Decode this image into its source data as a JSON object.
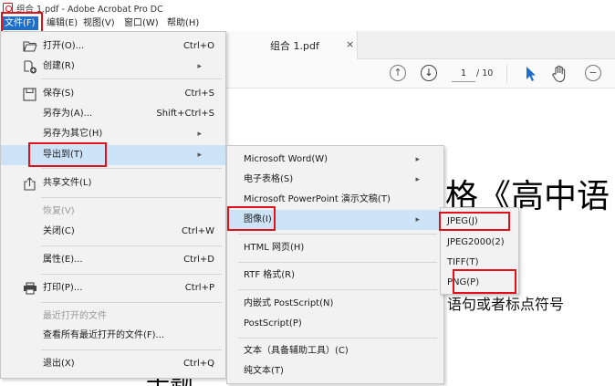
{
  "window": {
    "title": "组合 1.pdf - Adobe Acrobat Pro DC"
  },
  "menubar": {
    "items": [
      {
        "id": "file",
        "label": "文件(F)"
      },
      {
        "id": "edit",
        "label": "编辑(E)"
      },
      {
        "id": "view",
        "label": "视图(V)"
      },
      {
        "id": "window",
        "label": "窗口(W)"
      },
      {
        "id": "help",
        "label": "帮助(H)"
      }
    ]
  },
  "tab": {
    "title": "组合 1.pdf",
    "close": "×"
  },
  "toolbar": {
    "page_current": "1",
    "page_total": "/ 10"
  },
  "file_menu": {
    "open": {
      "label": "打开(O)...",
      "shortcut": "Ctrl+O"
    },
    "create": {
      "label": "创建(R)"
    },
    "save": {
      "label": "保存(S)",
      "shortcut": "Ctrl+S"
    },
    "save_as": {
      "label": "另存为(A)...",
      "shortcut": "Shift+Ctrl+S"
    },
    "save_as_other": {
      "label": "另存为其它(H)"
    },
    "export_to": {
      "label": "导出到(T)"
    },
    "share": {
      "label": "共享文件(L)"
    },
    "revert": {
      "label": "恢复(V)"
    },
    "close": {
      "label": "关闭(C)",
      "shortcut": "Ctrl+W"
    },
    "properties": {
      "label": "属性(E)...",
      "shortcut": "Ctrl+D"
    },
    "print": {
      "label": "打印(P)...",
      "shortcut": "Ctrl+P"
    },
    "recent": {
      "label": "最近打开的文件"
    },
    "view_all_recent": {
      "label": "查看所有最近打开的文件(F)..."
    },
    "exit": {
      "label": "退出(X)",
      "shortcut": "Ctrl+Q"
    }
  },
  "export_menu": {
    "word": {
      "label": "Microsoft Word(W)"
    },
    "spreadsheet": {
      "label": "电子表格(S)"
    },
    "powerpoint": {
      "label": "Microsoft PowerPoint 演示文稿(T)"
    },
    "image": {
      "label": "图像(I)"
    },
    "html": {
      "label": "HTML 网页(H)"
    },
    "rtf": {
      "label": "RTF 格式(R)"
    },
    "eps": {
      "label": "内嵌式 PostScript(N)"
    },
    "postscript": {
      "label": "PostScript(P)"
    },
    "accessible_text": {
      "label": "文本（具备辅助工具）(C)"
    },
    "plain_text": {
      "label": "纯文本(T)"
    }
  },
  "image_menu": {
    "jpeg": {
      "label": "JPEG(J)"
    },
    "jpeg2000": {
      "label": "JPEG2000(2)"
    },
    "tiff": {
      "label": "TIFF(T)"
    },
    "png": {
      "label": "PNG(P)"
    }
  },
  "document": {
    "heading_fragment": "格《高中语",
    "line_fragment": "语句或者标点符号",
    "bottom_fragment": "千题"
  },
  "colors": {
    "highlight_red": "#e0111b",
    "menu_file_bg": "#1e6fc9",
    "hover_blue": "#cde3f7"
  }
}
